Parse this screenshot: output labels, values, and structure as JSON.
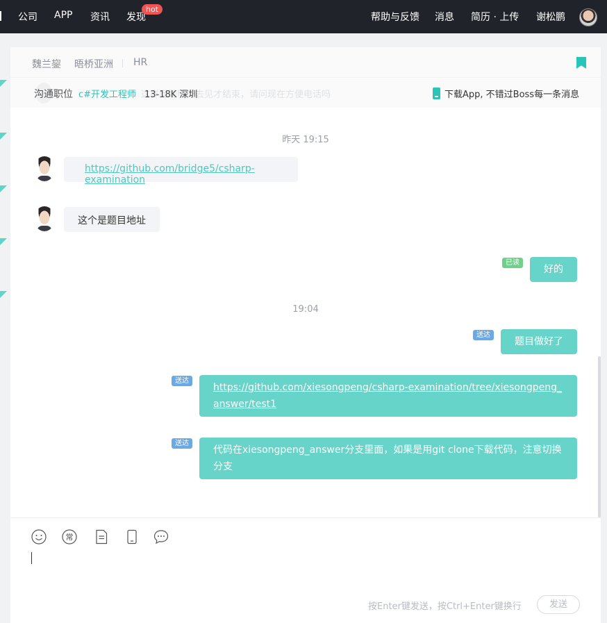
{
  "topnav": {
    "items_left": [
      "公司",
      "APP",
      "资讯",
      "发现"
    ],
    "hot_badge": "hot",
    "items_right": [
      "帮助与反馈",
      "消息",
      "简历 · 上传",
      "谢松鹏"
    ]
  },
  "chat_header": {
    "name": "魏兰鋆",
    "company": "晤桥亚洲",
    "role": "HR"
  },
  "job": {
    "label": "沟通职位",
    "position": "c#开发工程师",
    "salary_city": "13-18K 深圳",
    "ghost_text": "这样问题明天去见才结束，请问现在方便电话吗",
    "download_text": "下载App, 不错过Boss每一条消息"
  },
  "messages": {
    "time1": "昨天 19:15",
    "in1_link": "https://github.com/bridge5/csharp-examination",
    "in2_text": "这个是题目地址",
    "out1_tag": "已读",
    "out1_text": "好的",
    "time2": "19:04",
    "out2_tag": "送达",
    "out2_text": "题目做好了",
    "out3_tag": "送达",
    "out3_link": "https://github.com/xiesongpeng/csharp-examination/tree/xiesongpeng_answer/test1",
    "out4_tag": "送达",
    "out4_text": "代码在xiesongpeng_answer分支里面，如果是用git clone下载代码，注意切换分支"
  },
  "composer": {
    "hint": "按Enter键发送，按Ctrl+Enter键换行",
    "send_label": "发送",
    "common_phrase_icon_char": "常"
  },
  "colors": {
    "brand": "#28c5b8",
    "bubble_out": "#66d4c8",
    "nav_bg": "#202329"
  }
}
